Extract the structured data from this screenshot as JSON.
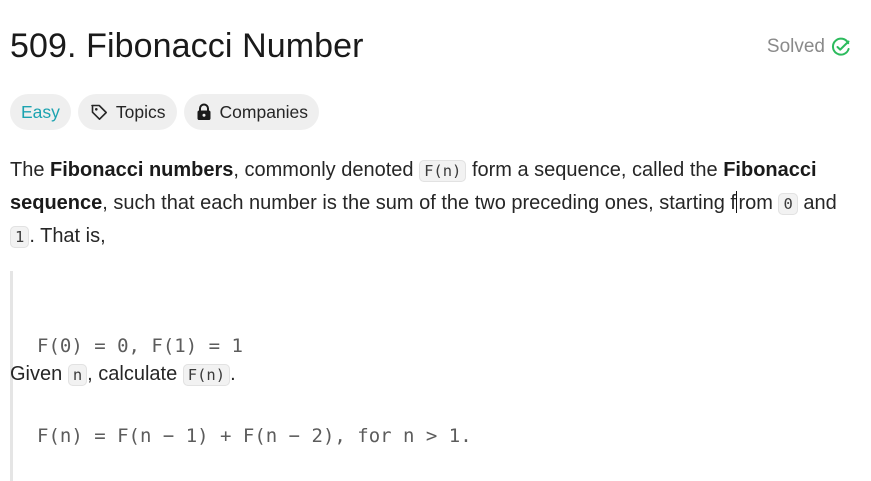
{
  "problem": {
    "title": "509. Fibonacci Number",
    "status": "Solved",
    "status_color": "#2cbb5d"
  },
  "tags": {
    "difficulty": "Easy",
    "topics": "Topics",
    "companies": "Companies",
    "difficulty_color": "#1ca3b0"
  },
  "description": {
    "t1": "The ",
    "b1": "Fibonacci numbers",
    "t2": ", commonly denoted ",
    "c1": "F(n)",
    "t3": " form a sequence, called the ",
    "b2": "Fibonacci sequence",
    "t4": ", such that each number is the sum of the two preceding ones, starting f",
    "t5": "rom ",
    "c2": "0",
    "t6": " and ",
    "c3": "1",
    "t7": ". That is,"
  },
  "code_block": {
    "line1": "F(0) = 0, F(1) = 1",
    "line2": "F(n) = F(n − 1) + F(n − 2), for n > 1."
  },
  "given": {
    "t1": "Given ",
    "c1": "n",
    "t2": ", calculate ",
    "c2": "F(n)",
    "t3": "."
  },
  "icons": {
    "status": "check-circle-icon",
    "topics": "tag-icon",
    "companies": "lock-icon"
  }
}
